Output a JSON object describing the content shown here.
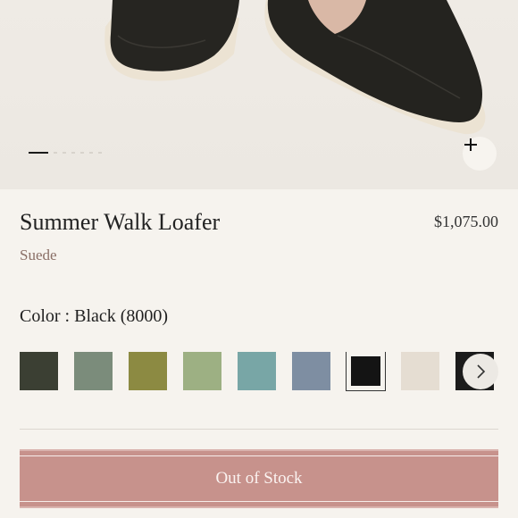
{
  "product": {
    "title": "Summer Walk Loafer",
    "price": "$1,075.00",
    "material": "Suede",
    "color_label": "Color : Black (8000)"
  },
  "gallery": {
    "zoom_icon": "plus-icon",
    "dot_count": 7,
    "active_index": 0
  },
  "swatches": [
    {
      "name": "dark-olive",
      "color": "#3b3f33",
      "selected": false
    },
    {
      "name": "sage",
      "color": "#7b8c7b",
      "selected": false
    },
    {
      "name": "olive",
      "color": "#8c8a42",
      "selected": false
    },
    {
      "name": "light-green",
      "color": "#9db083",
      "selected": false
    },
    {
      "name": "teal",
      "color": "#78a6a6",
      "selected": false
    },
    {
      "name": "slate-blue",
      "color": "#7e8ea2",
      "selected": false
    },
    {
      "name": "black",
      "color": "#141414",
      "selected": true
    },
    {
      "name": "cream",
      "color": "#e5ddd2",
      "selected": false
    },
    {
      "name": "charcoal",
      "color": "#1b1b1b",
      "selected": false
    }
  ],
  "swatch_next_icon": "chevron-right-icon",
  "cta": {
    "label": "Out of Stock",
    "color": "#c7928c"
  }
}
